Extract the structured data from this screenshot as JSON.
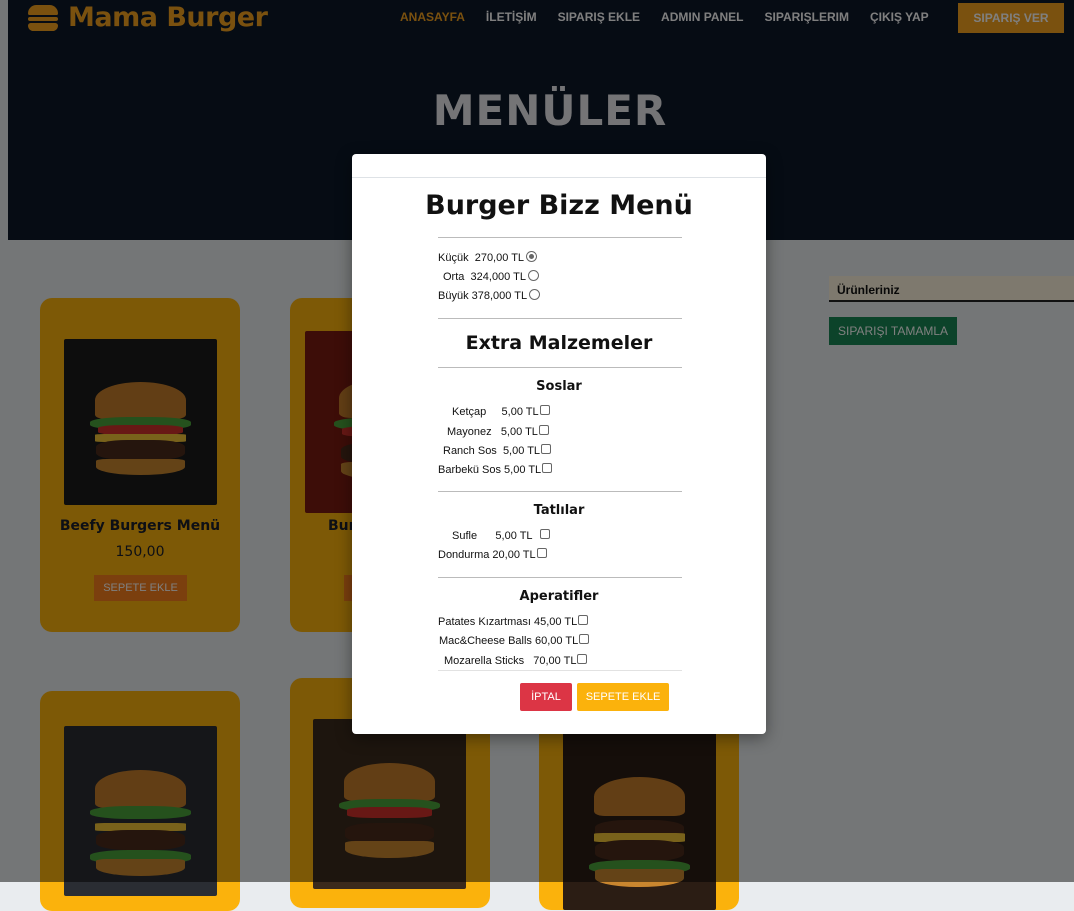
{
  "header": {
    "brand": "Mama Burger",
    "brand_icon": "burger-icon",
    "nav": [
      "ANASAYFA",
      "İLETİŞİM",
      "SIPARIŞ EKLE",
      "ADMIN PANEL",
      "SIPARIŞLERIM",
      "ÇIKIŞ YAP"
    ],
    "order_button": "SIPARIŞ VER",
    "accent_color": "#f4a21e"
  },
  "hero": {
    "title": "MENÜLER"
  },
  "cards": [
    {
      "name": "Beefy Burgers Menü",
      "price": "150,00",
      "button": "SEPETE EKLE"
    },
    {
      "name": "Bur",
      "button": ""
    }
  ],
  "sidebar": {
    "title": "Ürünleriniz",
    "complete_button": "SIPARIŞI TAMAMLA"
  },
  "modal": {
    "title": "Burger Bizz Menü",
    "sizes": [
      {
        "label": "Küçük",
        "price": "270,00 TL",
        "selected": true
      },
      {
        "label": "Orta",
        "price": "324,000 TL",
        "selected": false
      },
      {
        "label": "Büyük",
        "price": "378,000 TL",
        "selected": false
      }
    ],
    "extras_title": "Extra Malzemeler",
    "groups": [
      {
        "title": "Soslar",
        "items": [
          {
            "label": "Ketçap",
            "price": "5,00 TL"
          },
          {
            "label": "Mayonez",
            "price": "5,00 TL"
          },
          {
            "label": "Ranch Sos",
            "price": "5,00 TL"
          },
          {
            "label": "Barbekü Sos",
            "price": "5,00 TL"
          }
        ]
      },
      {
        "title": "Tatlılar",
        "items": [
          {
            "label": "Sufle",
            "price": "5,00 TL"
          },
          {
            "label": "Dondurma",
            "price": "20,00 TL"
          }
        ]
      },
      {
        "title": "Aperatifler",
        "items": [
          {
            "label": "Patates Kızartması",
            "price": "45,00 TL"
          },
          {
            "label": "Mac&Cheese Balls",
            "price": "60,00 TL"
          },
          {
            "label": "Mozarella Sticks",
            "price": "70,00 TL"
          }
        ]
      }
    ],
    "cancel_button": "İPTAL",
    "add_button": "SEPETE EKLE"
  }
}
